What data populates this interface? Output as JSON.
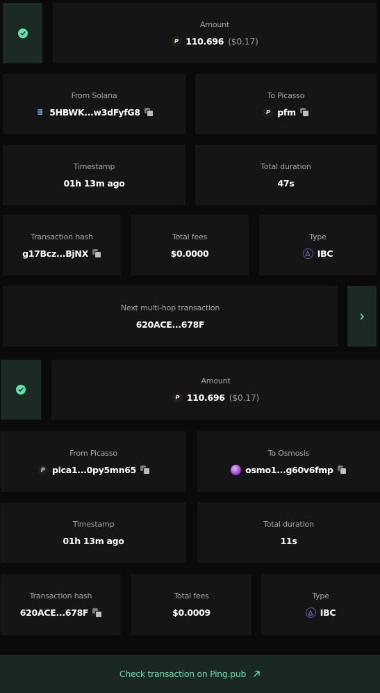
{
  "hops": [
    {
      "amount": {
        "label": "Amount",
        "value": "110.696",
        "usd": "($0.17)",
        "token_icon": "picasso-token-icon"
      },
      "from": {
        "label": "From Solana",
        "address": "5HBWK...w3dFyfG8",
        "icon": "solana-icon"
      },
      "to": {
        "label": "To Picasso",
        "address": "pfm",
        "icon": "picasso-token-icon"
      },
      "timestamp": {
        "label": "Timestamp",
        "value": "01h 13m ago"
      },
      "duration": {
        "label": "Total duration",
        "value": "47s"
      },
      "tx_hash": {
        "label": "Transaction hash",
        "value": "g17Bcz...BjNX"
      },
      "fees": {
        "label": "Total fees",
        "value": "$0.0000"
      },
      "type": {
        "label": "Type",
        "value": "IBC",
        "icon": "ibc-icon"
      },
      "next": {
        "label": "Next multi-hop transaction",
        "value": "620ACE...678F"
      }
    },
    {
      "amount": {
        "label": "Amount",
        "value": "110.696",
        "usd": "($0.17)",
        "token_icon": "picasso-token-icon"
      },
      "from": {
        "label": "From Picasso",
        "address": "pica1...0py5mn65",
        "icon": "picasso-token-icon"
      },
      "to": {
        "label": "To Osmosis",
        "address": "osmo1...g60v6fmp",
        "icon": "osmosis-icon"
      },
      "timestamp": {
        "label": "Timestamp",
        "value": "01h 13m ago"
      },
      "duration": {
        "label": "Total duration",
        "value": "11s"
      },
      "tx_hash": {
        "label": "Transaction hash",
        "value": "620ACE...678F"
      },
      "fees": {
        "label": "Total fees",
        "value": "$0.0009"
      },
      "type": {
        "label": "Type",
        "value": "IBC",
        "icon": "ibc-icon"
      }
    }
  ],
  "footer": {
    "label": "Check transaction on Ping.pub",
    "icon": "external-link-arrow-icon"
  },
  "colors": {
    "accent": "#5fe3b0",
    "card": "#151515",
    "status_bg": "#1b2a24",
    "background": "#0a0a0a"
  }
}
